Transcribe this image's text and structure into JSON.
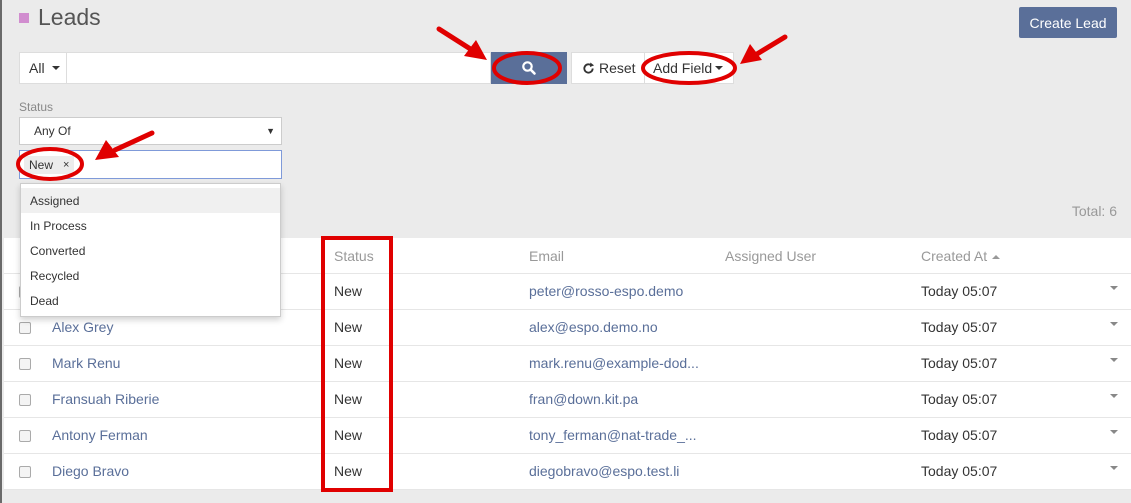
{
  "header": {
    "title": "Leads",
    "create_label": "Create Lead"
  },
  "search": {
    "scope": "All",
    "filter_value": "",
    "reset_label": "Reset",
    "add_field_label": "Add Field"
  },
  "status_filter": {
    "label": "Status",
    "operator": "Any Of",
    "selected_tag": "New",
    "tag_remove": "×",
    "options": [
      "Assigned",
      "In Process",
      "Converted",
      "Recycled",
      "Dead"
    ]
  },
  "total": "Total: 6",
  "table": {
    "columns": {
      "status": "Status",
      "email": "Email",
      "assigned_user": "Assigned User",
      "created_at": "Created At"
    },
    "rows": [
      {
        "name": "",
        "status": "New",
        "email": "peter@rosso-espo.demo",
        "created": "Today 05:07"
      },
      {
        "name": "Alex Grey",
        "status": "New",
        "email": "alex@espo.demo.no",
        "created": "Today 05:07"
      },
      {
        "name": "Mark Renu",
        "status": "New",
        "email": "mark.renu@example-dod...",
        "created": "Today 05:07"
      },
      {
        "name": "Fransuah Riberie",
        "status": "New",
        "email": "fran@down.kit.pa",
        "created": "Today 05:07"
      },
      {
        "name": "Antony Ferman",
        "status": "New",
        "email": "tony_ferman@nat-trade_...",
        "created": "Today 05:07"
      },
      {
        "name": "Diego Bravo",
        "status": "New",
        "email": "diegobravo@espo.test.li",
        "created": "Today 05:07"
      }
    ]
  },
  "colors": {
    "primary": "#5a6f99",
    "annotation": "#e00000",
    "brand": "#d18dcf"
  }
}
